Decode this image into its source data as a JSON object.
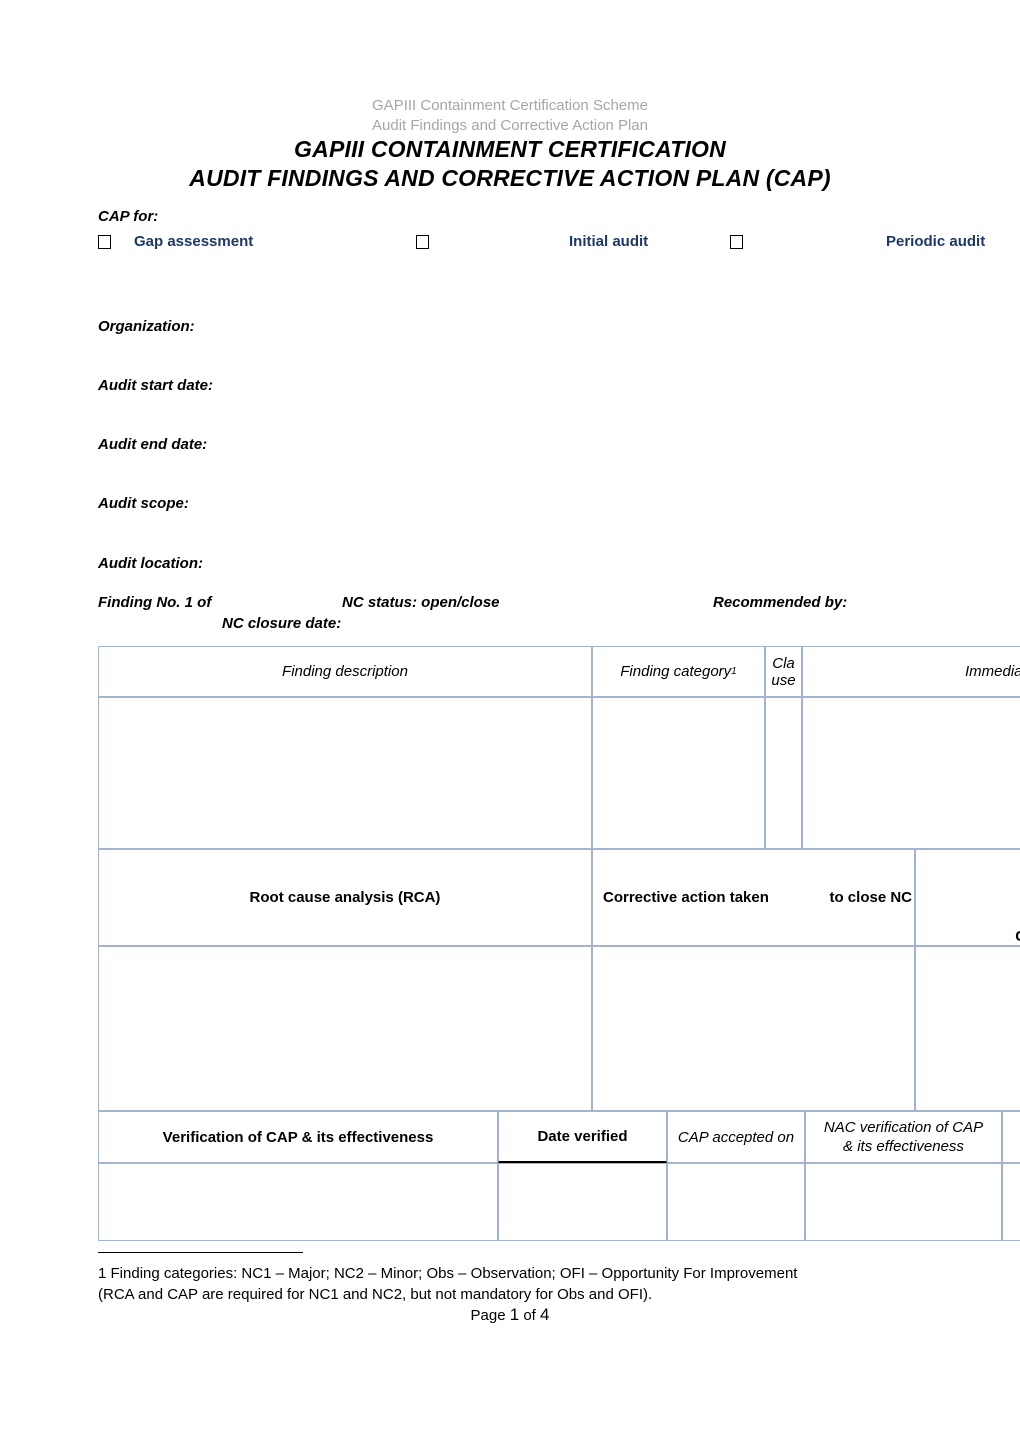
{
  "running_header": {
    "line1": "GAPIII Containment Certification Scheme",
    "line2": "Audit Findings and Corrective Action Plan"
  },
  "title": {
    "line1": "GAPIII CONTAINMENT CERTIFICATION",
    "line2": "AUDIT FINDINGS AND CORRECTIVE ACTION PLAN (CAP)"
  },
  "cap_for": {
    "label": "CAP for:",
    "options": [
      {
        "label": "Gap assessment",
        "checked": false
      },
      {
        "label": "Initial audit",
        "checked": false
      },
      {
        "label": "Periodic audit",
        "checked": false
      }
    ]
  },
  "fields": [
    {
      "label": "Organization:",
      "value": ""
    },
    {
      "label": "Audit start date:",
      "value": ""
    },
    {
      "label": "Audit end date:",
      "value": ""
    },
    {
      "label": "Audit scope:",
      "value": ""
    },
    {
      "label": "Audit location:",
      "value": ""
    }
  ],
  "finding_line": {
    "finding_no": "Finding No. 1 of",
    "nc_status": "NC status: open/close",
    "recommended_by": "Recommended by:",
    "nc_closure_date": "NC closure date:"
  },
  "table": {
    "header_row_1": {
      "finding_description": "Finding description",
      "finding_category": "Finding category",
      "finding_category_footnote_marker": "1",
      "clause": "Cla use",
      "clause_line1": "Cla",
      "clause_line2": "use",
      "immediate_correction": "Immediate"
    },
    "header_row_2": {
      "rca": "Root cause analysis (RCA)",
      "corrective_action": "Corrective action taken",
      "corrective_action_cont": "to close NC",
      "completion": "Completion"
    },
    "header_row_3": {
      "verification": "Verification of CAP & its effectiveness",
      "date_verified": "Date verified",
      "cap_accepted_on": "CAP accepted on",
      "nac_verification_line1": "NAC verification of CAP",
      "nac_verification_line2": "& its effectiveness"
    },
    "input_values": {
      "finding_description": "",
      "finding_category": "",
      "clause": "",
      "immediate_correction": "",
      "rca": "",
      "corrective_action": "",
      "completion": "",
      "verification": "",
      "date_verified": "",
      "cap_accepted_on": "",
      "nac_verification": ""
    }
  },
  "footnote": {
    "line1": "1  Finding categories: NC1 – Major; NC2 – Minor; Obs – Observation; OFI – Opportunity For Improvement",
    "line2": "(RCA and CAP are required for NC1 and NC2, but not mandatory for Obs and OFI)."
  },
  "page_footer": {
    "prefix": "Page ",
    "current": "1",
    "of": " of ",
    "total": "4"
  },
  "colors": {
    "table_border": "#a3b4cc",
    "checkbox_label": "#1f3864",
    "running_header": "#a6a6a6",
    "body_text": "#000000"
  }
}
